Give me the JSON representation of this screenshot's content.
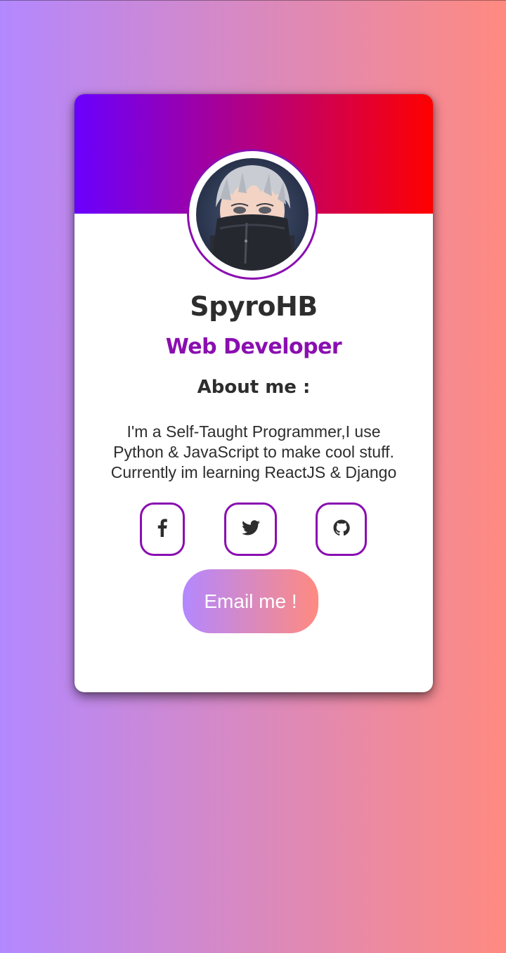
{
  "profile": {
    "name": "SpyroHB",
    "role": "Web Developer",
    "about_title": "About me :",
    "about_lines": [
      "I'm a Self-Taught Programmer,I use",
      "Python & JavaScript to make cool stuff.",
      "Currently im learning ReactJS & Django"
    ]
  },
  "social": [
    {
      "icon": "facebook-icon"
    },
    {
      "icon": "twitter-icon"
    },
    {
      "icon": "github-icon"
    }
  ],
  "actions": {
    "email_label": "Email me !"
  },
  "colors": {
    "accent": "#8a0eb0",
    "banner_start": "#6a00ff",
    "banner_end": "#ff0000",
    "page_start": "#b388ff",
    "page_end": "#ff8a80",
    "text": "#2d2d2d"
  }
}
